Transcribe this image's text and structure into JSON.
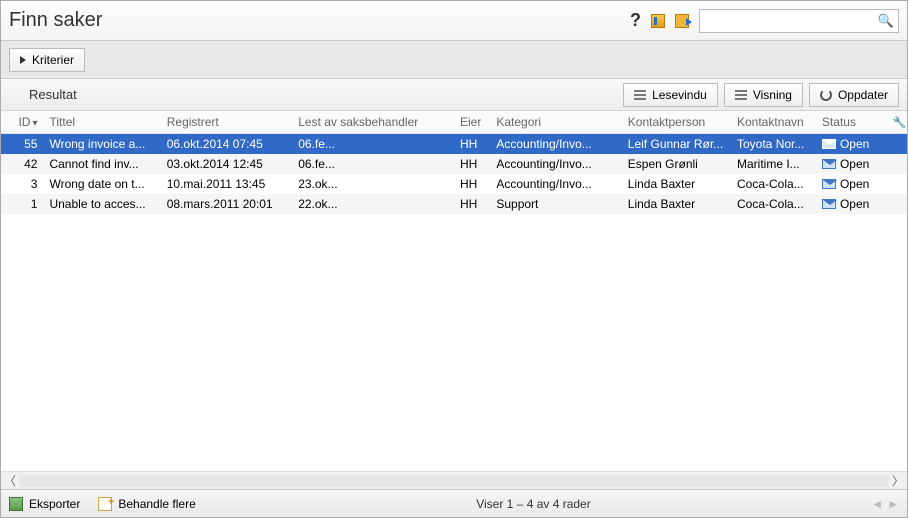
{
  "title": "Finn saker",
  "search": {
    "placeholder": ""
  },
  "criteria_label": "Kriterier",
  "result_label": "Resultat",
  "toolbar": {
    "preview": "Lesevindu",
    "view": "Visning",
    "refresh": "Oppdater"
  },
  "columns": {
    "id": "ID",
    "title": "Tittel",
    "registered": "Registrert",
    "read_by": "Lest av saksbehandler",
    "owner": "Eier",
    "category": "Kategori",
    "contact": "Kontaktperson",
    "contact_name": "Kontaktnavn",
    "status": "Status"
  },
  "rows": [
    {
      "id": "55",
      "title": "Wrong invoice a...",
      "registered": "06.okt.2014 07:45",
      "read_by": "06.fe...",
      "owner": "HH",
      "category": "Accounting/Invo...",
      "contact": "Leif Gunnar Rør...",
      "contact_name": "Toyota Nor...",
      "status": "Open",
      "selected": true
    },
    {
      "id": "42",
      "title": "Cannot find inv...",
      "registered": "03.okt.2014 12:45",
      "read_by": "06.fe...",
      "owner": "HH",
      "category": "Accounting/Invo...",
      "contact": "Espen Grønli",
      "contact_name": "Maritime I...",
      "status": "Open",
      "selected": false
    },
    {
      "id": "3",
      "title": "Wrong date on t...",
      "registered": "10.mai.2011 13:45",
      "read_by": "23.ok...",
      "owner": "HH",
      "category": "Accounting/Invo...",
      "contact": "Linda Baxter",
      "contact_name": "Coca-Cola...",
      "status": "Open",
      "selected": false
    },
    {
      "id": "1",
      "title": "Unable to acces...",
      "registered": "08.mars.2011 20:01",
      "read_by": "22.ok...",
      "owner": "HH",
      "category": "Support",
      "contact": "Linda Baxter",
      "contact_name": "Coca-Cola...",
      "status": "Open",
      "selected": false
    }
  ],
  "footer": {
    "export": "Eksporter",
    "batch": "Behandle flere",
    "status": "Viser 1 – 4 av 4 rader"
  }
}
